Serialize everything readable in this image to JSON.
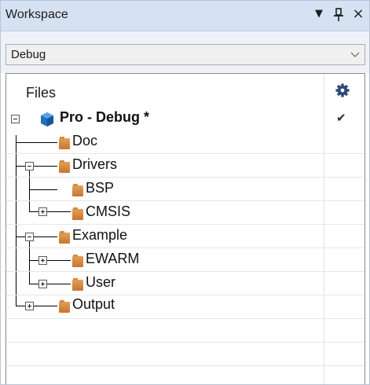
{
  "window": {
    "title": "Workspace",
    "buttons": {
      "dropdown_icon": "▼",
      "pin_icon": "ꟸ",
      "close_icon": "×"
    }
  },
  "config": {
    "selected": "Debug",
    "chevron": "⌵"
  },
  "tree": {
    "header": "Files",
    "project": {
      "label": "Pro - Debug *",
      "checked": "✔"
    },
    "nodes": {
      "doc": "Doc",
      "drivers": "Drivers",
      "bsp": "BSP",
      "cmsis": "CMSIS",
      "example": "Example",
      "ewarm": "EWARM",
      "user": "User",
      "output": "Output"
    }
  },
  "colors": {
    "titlebar": "#d6e1f1",
    "folder": "#d48a44",
    "project_icon": "#1f6fbf",
    "gear_icon": "#2b4a72"
  }
}
